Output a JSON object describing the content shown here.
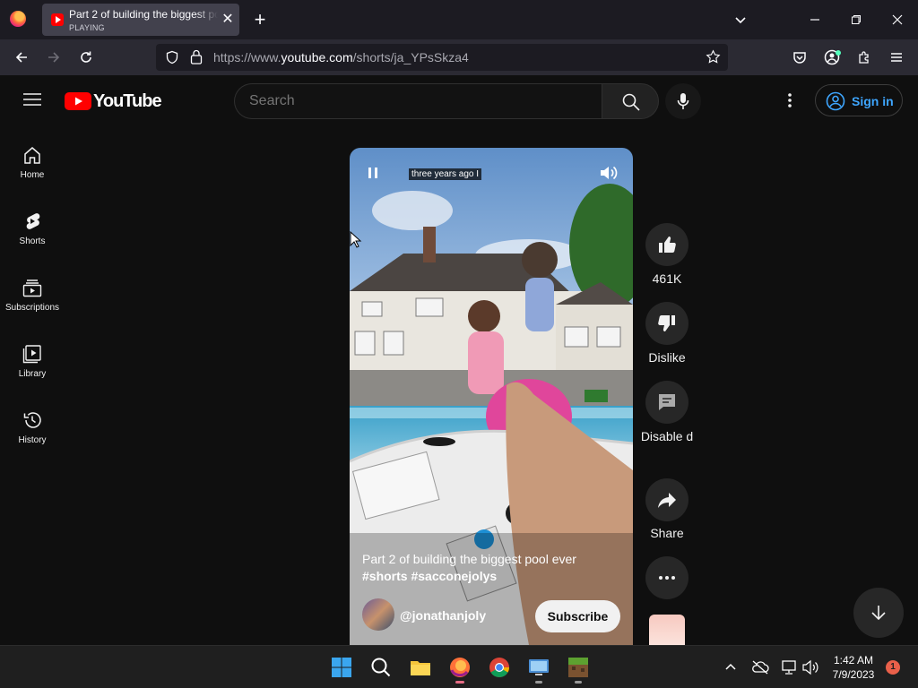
{
  "browser": {
    "tab_title": "Part 2 of building the biggest pool ever",
    "tab_status": "PLAYING",
    "url_prefix": "https://www.",
    "url_domain": "youtube.com",
    "url_path": "/shorts/ja_YPsSkza4"
  },
  "header": {
    "logo_text": "YouTube",
    "search_placeholder": "Search",
    "signin_label": "Sign in"
  },
  "sidebar": {
    "items": [
      {
        "label": "Home",
        "icon": "home-icon"
      },
      {
        "label": "Shorts",
        "icon": "shorts-icon"
      },
      {
        "label": "Subscriptions",
        "icon": "subscriptions-icon"
      },
      {
        "label": "Library",
        "icon": "library-icon"
      },
      {
        "label": "History",
        "icon": "history-icon"
      }
    ]
  },
  "video": {
    "caption": "three years ago I",
    "title": "Part 2 of building the biggest pool ever",
    "tags": "#shorts #sacconejolys",
    "channel": "@jonathanjoly",
    "subscribe_label": "Subscribe"
  },
  "actions": {
    "like_count": "461K",
    "dislike_label": "Dislike",
    "comments_label": "Disable d",
    "share_label": "Share"
  },
  "taskbar": {
    "time": "1:42 AM",
    "date": "7/9/2023",
    "notification_count": "1"
  },
  "colors": {
    "accent_blue": "#3ea6ff",
    "youtube_red": "#ff0000",
    "background": "#0f0f0f"
  }
}
